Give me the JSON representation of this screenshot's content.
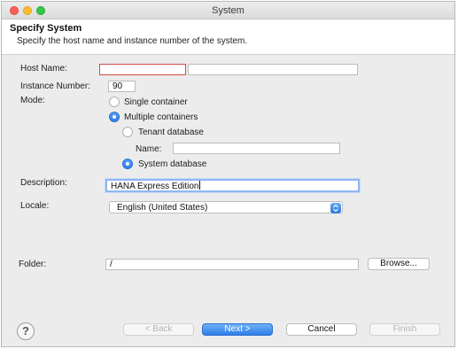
{
  "window": {
    "title": "System"
  },
  "header": {
    "title": "Specify System",
    "description": "Specify the host name and instance number of the system."
  },
  "form": {
    "host_name": {
      "label": "Host Name:",
      "value": ""
    },
    "instance_number": {
      "label": "Instance Number:",
      "value": "90"
    },
    "mode": {
      "label": "Mode:",
      "single_container": "Single container",
      "multiple_containers": "Multiple containers",
      "selected": "Multiple containers",
      "tenant_database": "Tenant database",
      "name": {
        "label": "Name:",
        "value": ""
      },
      "system_database": "System database",
      "database_selected": "System database"
    },
    "description": {
      "label": "Description:",
      "value": "HANA Express Edition"
    },
    "locale": {
      "label": "Locale:",
      "value": "English (United States)"
    },
    "folder": {
      "label": "Folder:",
      "value": "/",
      "browse_label": "Browse..."
    }
  },
  "footer": {
    "help_glyph": "?",
    "back_label": "< Back",
    "next_label": "Next >",
    "cancel_label": "Cancel",
    "finish_label": "Finish"
  },
  "colors": {
    "accent": "#2f7ee8",
    "error_border": "#d14a43",
    "focus_ring": "#8fb6f0"
  },
  "icons": {
    "close": "close-icon",
    "minimize": "minimize-icon",
    "zoom": "zoom-icon",
    "select_arrows": "chevron-updown-icon",
    "help": "help-icon"
  }
}
